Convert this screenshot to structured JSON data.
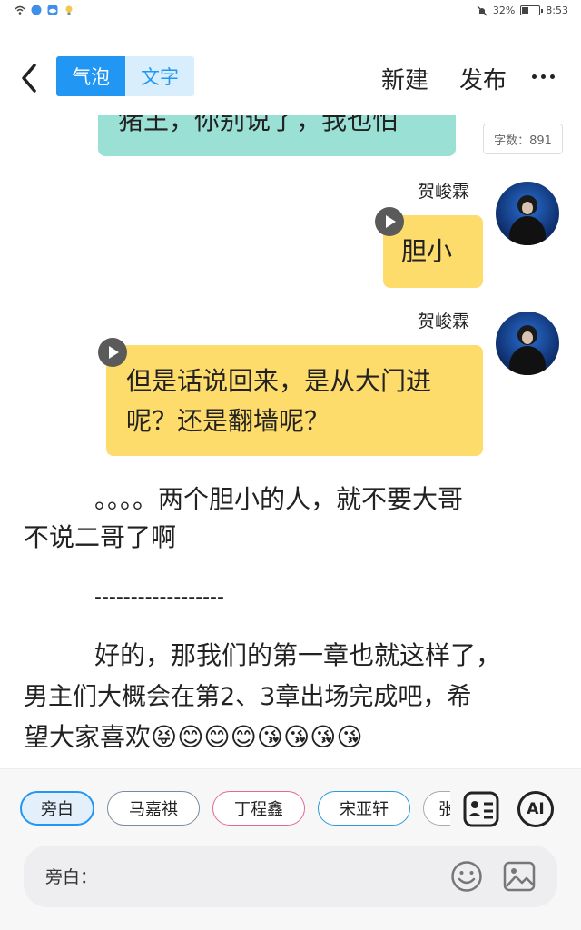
{
  "status_bar": {
    "battery_text": "32%",
    "battery_level": 0.32,
    "time": "8:53"
  },
  "header": {
    "toggle_bubble": "气泡",
    "toggle_text": "文字",
    "new_label": "新建",
    "publish_label": "发布"
  },
  "word_count": "字数：891",
  "messages": [
    {
      "text": "猪王，你别说了，我也怕",
      "color": "#9be0d5"
    },
    {
      "speaker": "贺峻霖",
      "text": "胆小",
      "color": "#fddc6c"
    },
    {
      "speaker": "贺峻霖",
      "line1": "但是话说回来，是从大门进",
      "line2": "呢？还是翻墙呢？",
      "color": "#fddc6c"
    }
  ],
  "narration": {
    "p1_line1": "。。。。两个胆小的人，就不要大哥",
    "p1_line2": "不说二哥了啊",
    "divider": "------------------",
    "p2_line1": "好的，那我们的第一章也就这样了，",
    "p2_line2": "男主们大概会在第2、3章出场完成吧，希",
    "p2_line3": "望大家喜欢😝😊😊😊😘😘😘😘"
  },
  "characters": [
    {
      "label": "旁白",
      "border": "#2196f3",
      "selected": true
    },
    {
      "label": "马嘉祺",
      "border": "#7d8a9a"
    },
    {
      "label": "丁程鑫",
      "border": "#e46a8c"
    },
    {
      "label": "宋亚轩",
      "border": "#2a9bd6"
    },
    {
      "label": "张",
      "border": "#aaaaaa"
    }
  ],
  "ai_label": "AI",
  "input": {
    "label": "旁白："
  },
  "colors": {
    "accent": "#2196f3",
    "teal_bubble": "#9be0d5",
    "yellow_bubble": "#fddc6c"
  }
}
